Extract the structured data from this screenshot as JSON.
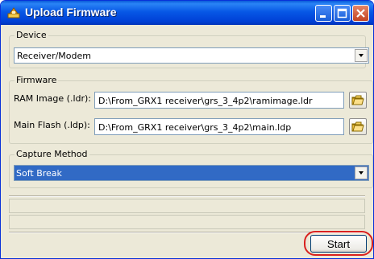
{
  "window": {
    "title": "Upload Firmware",
    "accent": "#0054e3"
  },
  "device": {
    "group_label": "Device",
    "selected": "Receiver/Modem"
  },
  "firmware": {
    "group_label": "Firmware",
    "ram_label": "RAM Image (.ldr):",
    "ram_path": "D:\\From_GRX1 receiver\\grs_3_4p2\\ramimage.ldr",
    "flash_label": "Main Flash (.ldp):",
    "flash_path": "D:\\From_GRX1 receiver\\grs_3_4p2\\main.ldp"
  },
  "capture": {
    "group_label": "Capture Method",
    "selected": "Soft Break",
    "selection_color": "#316ac5"
  },
  "actions": {
    "start_label": "Start",
    "highlight_color": "#d9211e"
  }
}
